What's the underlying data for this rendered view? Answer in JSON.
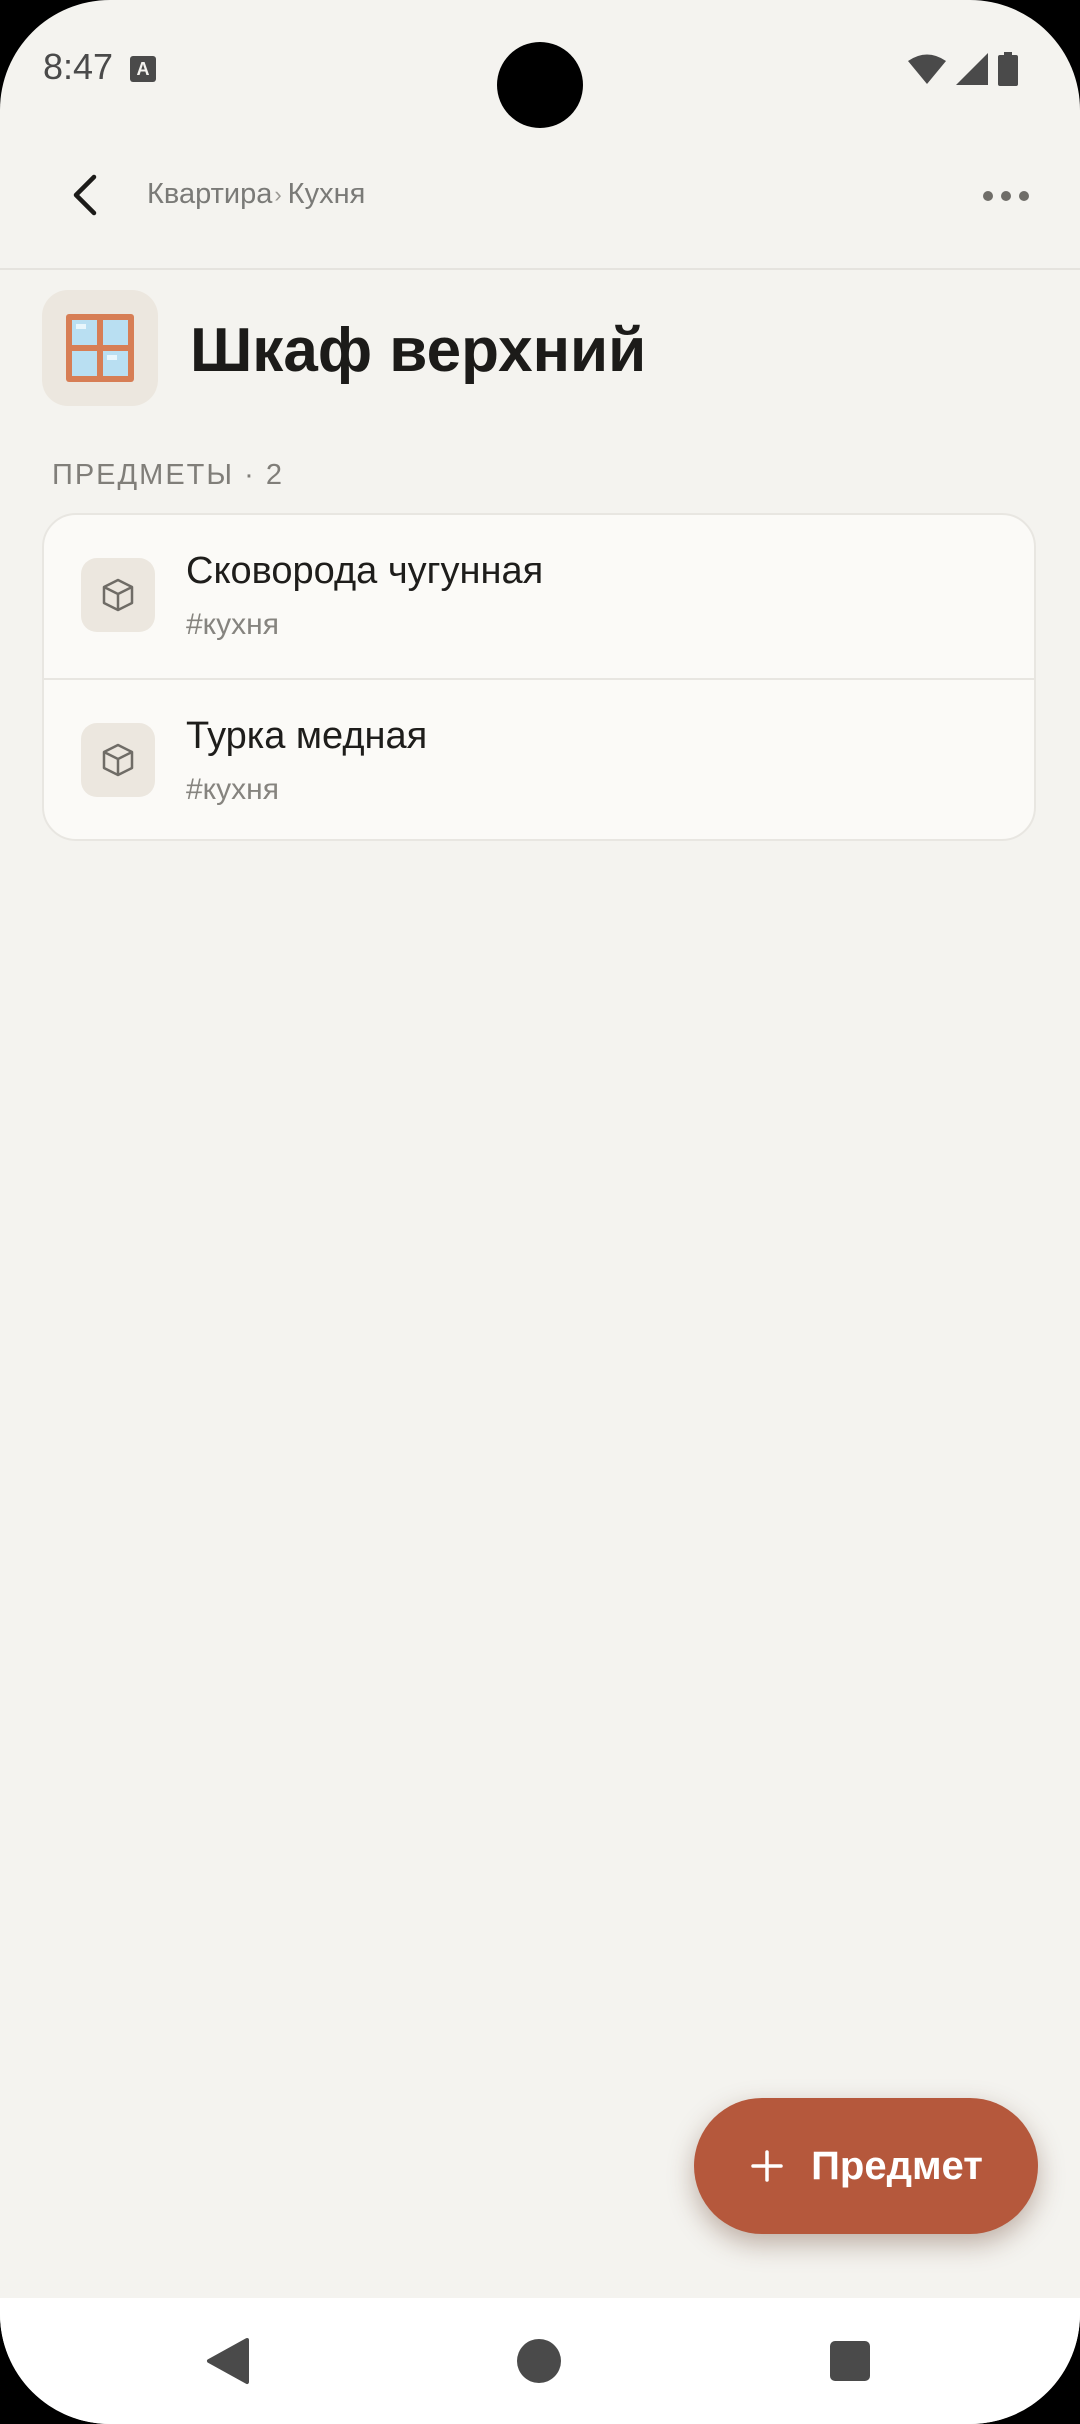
{
  "status_bar": {
    "time": "8:47",
    "notification_letter": "A"
  },
  "topbar": {
    "breadcrumb": [
      "Квартира",
      "Кухня"
    ],
    "separator": "›",
    "back_icon": "chevron-left-icon",
    "more_icon": "more-horizontal-icon"
  },
  "header": {
    "emoji": "🪟",
    "title": "Шкаф верхний"
  },
  "section": {
    "label": "ПРЕДМЕТЫ · 2"
  },
  "items": [
    {
      "title": "Сковорода чугунная",
      "tag": "#кухня",
      "icon": "box-icon"
    },
    {
      "title": "Турка медная",
      "tag": "#кухня",
      "icon": "box-icon"
    }
  ],
  "fab": {
    "label": "Предмет",
    "icon": "plus-icon"
  },
  "colors": {
    "accent": "#b5583c",
    "background": "#f4f3ef",
    "card": "#fbfaf7"
  }
}
